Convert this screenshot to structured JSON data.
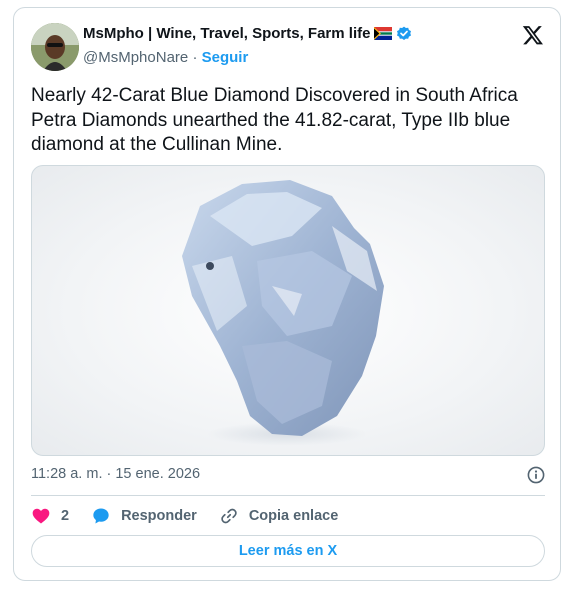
{
  "author": {
    "display_name": "MsMpho | Wine, Travel, Sports, Farm life",
    "handle": "@MsMphoNare",
    "separator": "·",
    "follow_label": "Seguir"
  },
  "tweet": {
    "lines": [
      "Nearly 42-Carat Blue Diamond Discovered in South Africa",
      "Petra Diamonds unearthed the 41.82-carat, Type IIb blue",
      "diamond at the Cullinan Mine."
    ],
    "timestamp": "11:28 a. m. · 15 ene. 2026"
  },
  "actions": {
    "likes_count": "2",
    "reply_label": "Responder",
    "copy_label": "Copia enlace"
  },
  "read_more_label": "Leer más en X",
  "colors": {
    "accent": "#1d9bf0",
    "like": "#f91880",
    "border": "#cfd9de",
    "muted": "#536471"
  }
}
